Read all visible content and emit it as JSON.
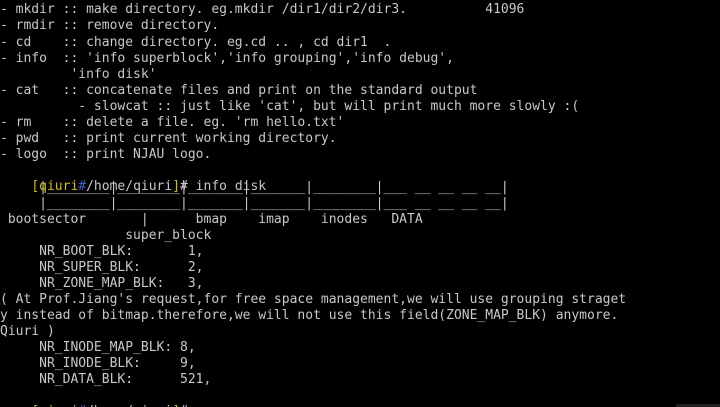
{
  "terminal": {
    "lines": [
      "- mkdir :: make directory. eg.mkdir /dir1/dir2/dir3.          41096",
      "- rmdir :: remove directory.",
      "- cd    :: change directory. eg.cd .. , cd dir1  .",
      "- info  :: 'info superblock','info grouping','info debug',",
      "         'info disk'",
      "- cat   :: concatenate files and print on the standard output",
      "          - slowcat :: just like 'cat', but will print much more slowly :(",
      "- rm    :: delete a file. eg. 'rm hello.txt'",
      "- pwd   :: print current working directory.",
      "- logo  :: print NJAU logo.",
      "",
      "     |________|________|_______|_______|________|___ __ __ __ __|",
      "     |________|________|_______|_______|________|___ __ __ __ __|",
      " bootsector       |      bmap    imap    inodes   DATA",
      "                super_block",
      "     NR_BOOT_BLK:       1,",
      "     NR_SUPER_BLK:      2,",
      "     NR_ZONE_MAP_BLK:   3,",
      "( At Prof.Jiang's request,for free space management,we will use grouping straget",
      "y instead of bitmap.therefore,we will not use this field(ZONE_MAP_BLK) anymore.",
      "Qiuri )",
      "     NR_INODE_MAP_BLK: 8,",
      "     NR_INODE_BLK:     9,",
      "     NR_DATA_BLK:      521,",
      ""
    ],
    "prompt": {
      "open": "[",
      "user": "qiuri",
      "sep": "#",
      "path": "/home/qiuri",
      "close": "]",
      "symbol": "#"
    },
    "commands": {
      "info_disk": " info disk",
      "current": " "
    }
  },
  "colors": {
    "background": "#000000",
    "text": "#c8c8c8",
    "prompt_user": "#d0c000",
    "prompt_sep": "#4060d0"
  }
}
